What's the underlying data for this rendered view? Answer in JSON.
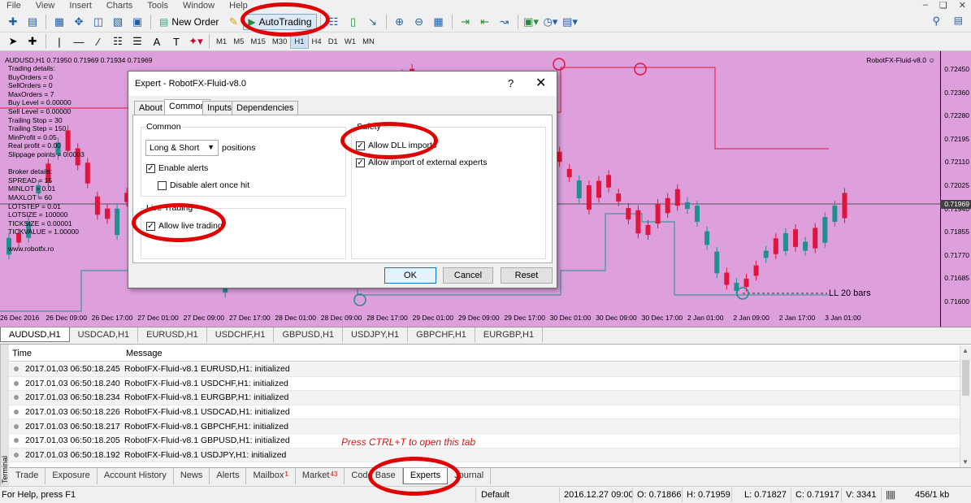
{
  "menubar": {
    "items": [
      "File",
      "View",
      "Insert",
      "Charts",
      "Tools",
      "Window",
      "Help"
    ]
  },
  "toolbar": {
    "new_order": "New Order",
    "autotrading": "AutoTrading"
  },
  "timeframes": [
    "M1",
    "M5",
    "M15",
    "M30",
    "H1",
    "H4",
    "D1",
    "W1",
    "MN"
  ],
  "timeframe_selected": "H1",
  "chart": {
    "symbol_line": "AUDUSD,H1  0.71950 0.71969 0.71934 0.71969",
    "bot_name": "RobotFX-Fluid-v8.0 ☺",
    "info_lines": [
      "Trading details:",
      "BuyOrders = 0",
      "SellOrders = 0",
      "MaxOrders = 7",
      "Buy Level = 0.00000",
      "Sell Level = 0.00000",
      "Trailing Stop = 30",
      "Trailing Step = 150",
      "MinProfit = 0.05",
      "Real profit = 0.00",
      "Slippage points = 0.0003",
      "",
      "Broker details:",
      "SPREAD = 15",
      "MINLOT = 0.01",
      "MAXLOT = 60",
      "LOTSTEP = 0.01",
      "LOTSIZE = 100000",
      "TICKSIZE = 0.00001",
      "TICKVALUE = 1.00000",
      "",
      "www.robotfx.ro"
    ],
    "price_labels": [
      "0.72450",
      "0.72360",
      "0.72280",
      "0.72195",
      "0.72110",
      "0.72025",
      "0.71940",
      "0.71855",
      "0.71770",
      "0.71685",
      "0.71600"
    ],
    "current_price": "0.71969",
    "time_labels": [
      "26 Dec 2016",
      "26 Dec 09:00",
      "26 Dec 17:00",
      "27 Dec 01:00",
      "27 Dec 09:00",
      "27 Dec 17:00",
      "28 Dec 01:00",
      "28 Dec 09:00",
      "28 Dec 17:00",
      "29 Dec 01:00",
      "29 Dec 09:00",
      "29 Dec 17:00",
      "30 Dec 01:00",
      "30 Dec 09:00",
      "30 Dec 17:00",
      "2 Jan 01:00",
      "2 Jan 09:00",
      "2 Jan 17:00",
      "3 Jan 01:00"
    ],
    "annotation": "LL 20 bars",
    "colors": {
      "background": "#dda0dd",
      "bull": "#1f8f8f",
      "bear": "#e0143c"
    }
  },
  "dialog": {
    "title": "Expert - RobotFX-Fluid-v8.0",
    "help": "?",
    "close": "✕",
    "tabs": [
      "About",
      "Common",
      "Inputs",
      "Dependencies"
    ],
    "selected_tab": "Common",
    "common_group": "Common",
    "positions_value": "Long & Short",
    "positions_label": "positions",
    "enable_alerts": "Enable alerts",
    "disable_alert": "Disable alert once hit",
    "live_group": "Live Trading",
    "allow_live": "Allow live trading",
    "safety_group": "Safety",
    "allow_dll": "Allow DLL imports",
    "allow_external": "Allow import of external experts",
    "ok": "OK",
    "cancel": "Cancel",
    "reset": "Reset"
  },
  "symbol_tabs": [
    "AUDUSD,H1",
    "USDCAD,H1",
    "EURUSD,H1",
    "USDCHF,H1",
    "GBPUSD,H1",
    "USDJPY,H1",
    "GBPCHF,H1",
    "EURGBP,H1"
  ],
  "log": {
    "headers": [
      "Time",
      "Message"
    ],
    "rows": [
      {
        "time": "2017.01.03 06:50:18.245",
        "msg": "RobotFX-Fluid-v8.1 EURUSD,H1: initialized"
      },
      {
        "time": "2017.01.03 06:50:18.240",
        "msg": "RobotFX-Fluid-v8.1 USDCHF,H1: initialized"
      },
      {
        "time": "2017.01.03 06:50:18.234",
        "msg": "RobotFX-Fluid-v8.1 EURGBP,H1: initialized"
      },
      {
        "time": "2017.01.03 06:50:18.226",
        "msg": "RobotFX-Fluid-v8.1 USDCAD,H1: initialized"
      },
      {
        "time": "2017.01.03 06:50:18.217",
        "msg": "RobotFX-Fluid-v8.1 GBPCHF,H1: initialized"
      },
      {
        "time": "2017.01.03 06:50:18.205",
        "msg": "RobotFX-Fluid-v8.1 GBPUSD,H1: initialized"
      },
      {
        "time": "2017.01.03 06:50:18.192",
        "msg": "RobotFX-Fluid-v8.1 USDJPY,H1: initialized"
      }
    ],
    "hint": "Press CTRL+T to open this tab"
  },
  "terminal_label": "Terminal",
  "terminal_tabs": [
    {
      "label": "Trade",
      "badge": ""
    },
    {
      "label": "Exposure",
      "badge": ""
    },
    {
      "label": "Account History",
      "badge": ""
    },
    {
      "label": "News",
      "badge": ""
    },
    {
      "label": "Alerts",
      "badge": ""
    },
    {
      "label": "Mailbox",
      "badge": "1"
    },
    {
      "label": "Market",
      "badge": "43"
    },
    {
      "label": "Code Base",
      "badge": ""
    },
    {
      "label": "Experts",
      "badge": ""
    },
    {
      "label": "Journal",
      "badge": ""
    }
  ],
  "terminal_selected": "Experts",
  "status": {
    "help": "For Help, press F1",
    "profile": "Default",
    "datetime": "2016.12.27 09:00",
    "open": "O: 0.71866",
    "high": "H: 0.71959",
    "low": "L: 0.71827",
    "close": "C: 0.71917",
    "volume": "V: 3341",
    "traffic": "456/1 kb"
  }
}
